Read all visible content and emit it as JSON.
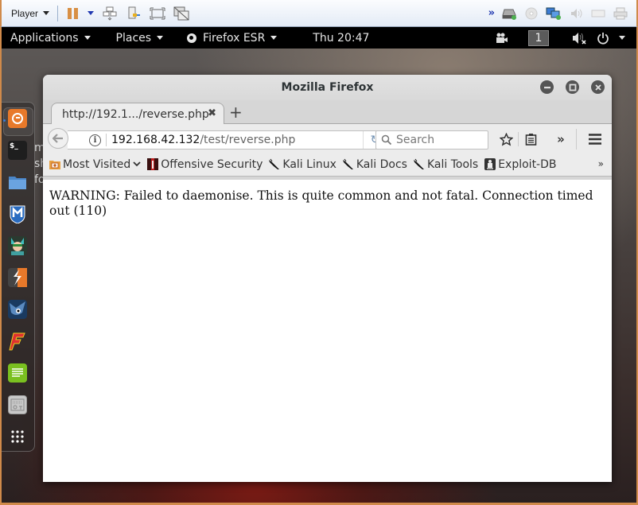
{
  "player": {
    "menu_label": "Player",
    "toolbar_icons": [
      "pause-icon",
      "dropdown-icon",
      "send-ctrl-alt-del-icon",
      "removable-devices-icon",
      "fullscreen-icon",
      "unity-icon"
    ],
    "device_icons": [
      "more-devices-icon",
      "hard-disk-icon",
      "cd-dvd-icon",
      "network-adapter-icon",
      "sound-card-icon",
      "usb-controller-icon",
      "printer-icon"
    ]
  },
  "gnome_bar": {
    "applications": "Applications",
    "places": "Places",
    "app_menu": "Firefox ESR",
    "clock": "Thu 20:47",
    "workspace": "1"
  },
  "desktop": {
    "partial_labels": [
      "m",
      "sh",
      "fol"
    ]
  },
  "dock": {
    "items": [
      "firefox",
      "terminal",
      "files",
      "metasploit",
      "armitage",
      "burpsuite",
      "maltego",
      "faraday",
      "leafpad",
      "cherrytree",
      "show-applications"
    ]
  },
  "firefox": {
    "window_title": "Mozilla Firefox",
    "tab_title": "http://192.1.../reverse.php",
    "url_host": "192.168.42.132",
    "url_path": "/test/reverse.php",
    "search_placeholder": "Search",
    "bookmarks": [
      {
        "label": "Most Visited",
        "icon": "folder-icon"
      },
      {
        "label": "Offensive Security",
        "icon": "offsec-icon"
      },
      {
        "label": "Kali Linux",
        "icon": "kali-dragon-icon"
      },
      {
        "label": "Kali Docs",
        "icon": "kali-dragon-icon"
      },
      {
        "label": "Kali Tools",
        "icon": "kali-dragon-icon"
      },
      {
        "label": "Exploit-DB",
        "icon": "exploitdb-icon"
      }
    ],
    "page_text": "WARNING: Failed to daemonise. This is quite common and not fatal. Connection timed out (110)"
  },
  "colors": {
    "vm_border": "#d08a4a",
    "gnome_bar": "#000000",
    "pause": "#d88f44"
  }
}
